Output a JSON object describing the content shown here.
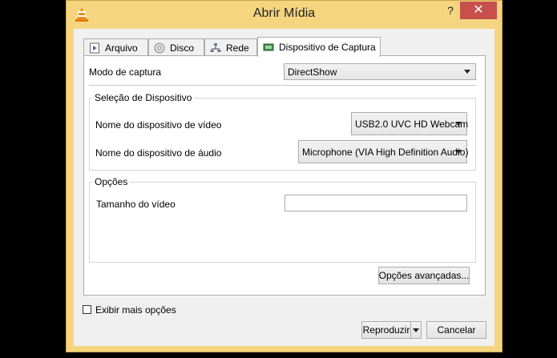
{
  "window": {
    "title": "Abrir Mídia",
    "help": "?",
    "close": "✕"
  },
  "tabs": [
    {
      "label": "Arquivo",
      "icon": "file-icon"
    },
    {
      "label": "Disco",
      "icon": "disc-icon"
    },
    {
      "label": "Rede",
      "icon": "network-icon"
    },
    {
      "label": "Dispositivo de Captura",
      "icon": "capture-device-icon",
      "active": true
    }
  ],
  "capture": {
    "mode_label": "Modo de captura",
    "mode_value": "DirectShow",
    "device_group": {
      "title": "Seleção de Dispositivo",
      "video_label": "Nome do dispositivo de vídeo",
      "video_value": "USB2.0 UVC HD Webcam",
      "audio_label": "Nome do dispositivo de áudio",
      "audio_value": "Microphone (VIA High Definition Audio)"
    },
    "options_group": {
      "title": "Opções",
      "video_size_label": "Tamanho do vídeo",
      "video_size_value": ""
    },
    "advanced_button": "Opções avançadas..."
  },
  "footer": {
    "show_more_label": "Exibir mais opções",
    "play_button": "Reproduzir",
    "cancel_button": "Cancelar"
  },
  "colors": {
    "frame": "#f5d57f",
    "close": "#c7504c"
  }
}
